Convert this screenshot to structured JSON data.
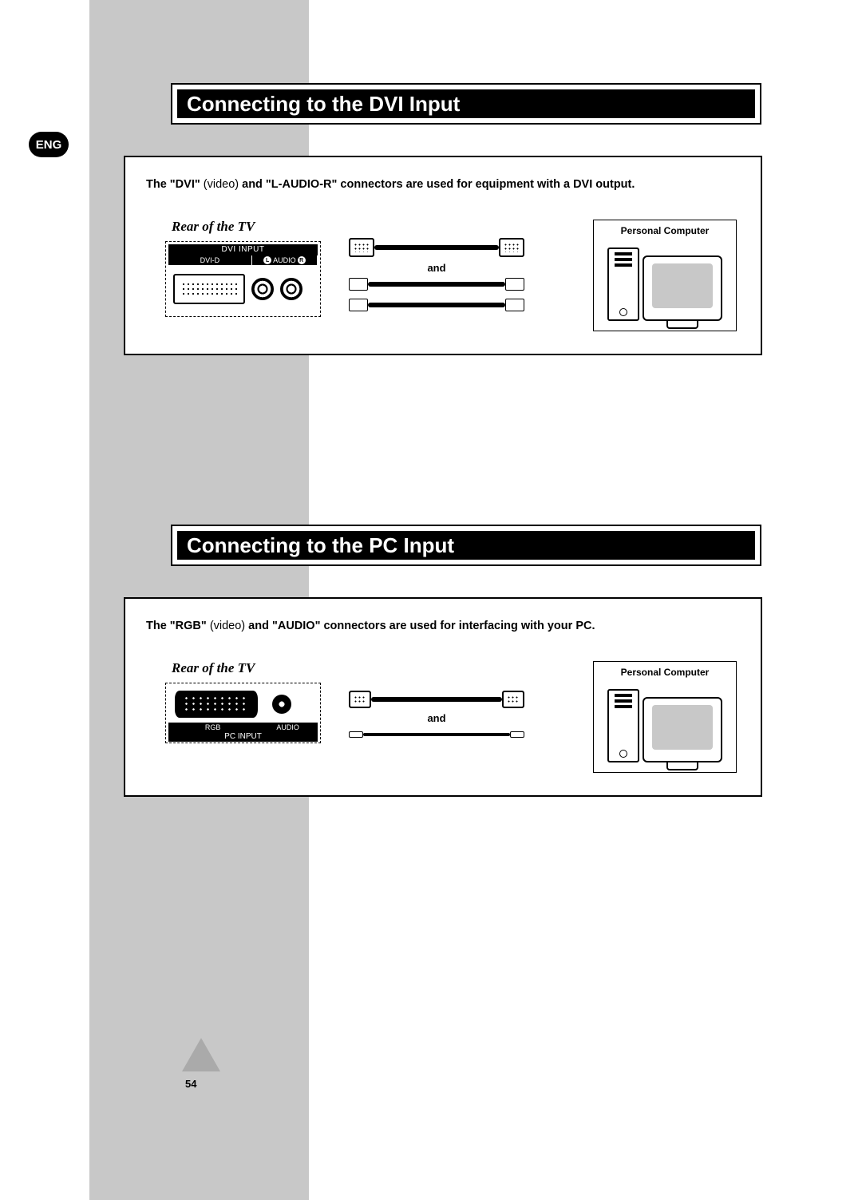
{
  "lang_badge": "ENG",
  "page_number": "54",
  "section1": {
    "title": "Connecting to the DVI Input",
    "desc_parts": {
      "p1": "The \"DVI\" ",
      "p2": "(video) ",
      "p3": "and \"L-AUDIO-R\" connectors are used for equipment with a DVI output."
    },
    "rear_label": "Rear of the TV",
    "panel": {
      "header": "DVI INPUT",
      "dvi_d": "DVI-D",
      "audio_l": "L",
      "audio_mid": "AUDIO",
      "audio_r": "R"
    },
    "and_label": "and",
    "pc_label": "Personal Computer"
  },
  "section2": {
    "title": "Connecting to the PC Input",
    "desc_parts": {
      "p1": "The \"RGB\" ",
      "p2": "(video) ",
      "p3": "and \"AUDIO\" connectors are used for interfacing with your PC."
    },
    "rear_label": "Rear of the TV",
    "panel": {
      "rgb": "RGB",
      "audio": "AUDIO",
      "footer": "PC INPUT"
    },
    "and_label": "and",
    "pc_label": "Personal Computer"
  }
}
